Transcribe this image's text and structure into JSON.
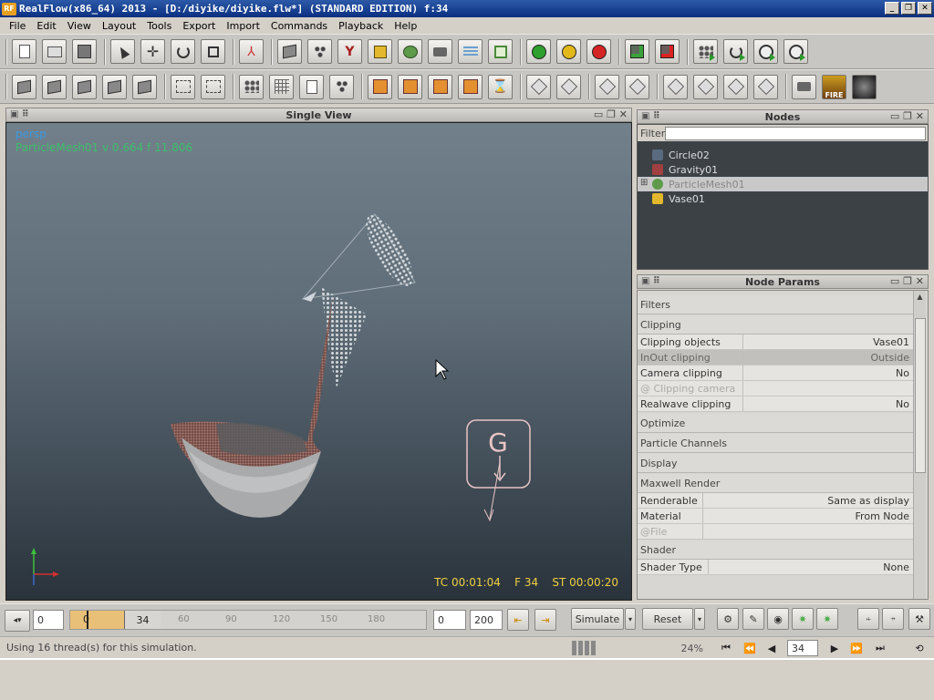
{
  "window": {
    "title": "RealFlow(x86_64) 2013 - [D:/diyike/diyike.flw*] (STANDARD EDITION) f:34",
    "app_icon": "RF",
    "minimize": "_",
    "maximize": "❐",
    "close": "✕"
  },
  "menu": [
    "File",
    "Edit",
    "View",
    "Layout",
    "Tools",
    "Export",
    "Import",
    "Commands",
    "Playback",
    "Help"
  ],
  "viewport": {
    "title": "Single View",
    "camera": "persp",
    "info": "ParticleMesh01 v 0.664 f 11.806",
    "gravity_label": "G",
    "timecode": "TC 00:01:04    F 34    ST 00:00:20"
  },
  "nodes": {
    "title": "Nodes",
    "filter_label": "Filter",
    "items": [
      {
        "label": "Circle02",
        "icon": "emitter-icon",
        "color": "#5a6a80"
      },
      {
        "label": "Gravity01",
        "icon": "daemon-icon",
        "color": "#a04040"
      },
      {
        "label": "ParticleMesh01",
        "icon": "mesh-icon",
        "color": "#5d9a4a"
      },
      {
        "label": "Vase01",
        "icon": "object-icon",
        "color": "#e3b82c"
      }
    ]
  },
  "params": {
    "title": "Node Params",
    "sections": {
      "filters": "Filters",
      "clipping": "Clipping",
      "optimize": "Optimize",
      "channels": "Particle Channels",
      "display": "Display",
      "maxwell": "Maxwell Render",
      "shader": "Shader"
    },
    "clipping_rows": [
      {
        "label": "Clipping objects",
        "value": "Vase01"
      },
      {
        "label": "InOut clipping",
        "value": "Outside"
      },
      {
        "label": "Camera clipping",
        "value": "No"
      },
      {
        "label": "@ Clipping camera",
        "value": ""
      },
      {
        "label": "Realwave clipping",
        "value": "No"
      }
    ],
    "maxwell_rows": [
      {
        "label": "Renderable",
        "value": "Same as display"
      },
      {
        "label": "Material",
        "value": "From Node"
      },
      {
        "label": "@File",
        "value": ""
      }
    ],
    "shader_rows": [
      {
        "label": "Shader Type",
        "value": "None"
      }
    ]
  },
  "timeline": {
    "start": "0",
    "range_start": "0",
    "current_frame": "34",
    "ticks": [
      "60",
      "90",
      "120",
      "150",
      "180"
    ],
    "end_start": "0",
    "end": "200",
    "simulate": "Simulate",
    "reset": "Reset",
    "range_fraction": 0.15
  },
  "status": {
    "message": "Using 16 thread(s) for this simulation.",
    "progress": "24%",
    "frame_field": "34"
  },
  "colors": {
    "accent": "#0b2f80",
    "mesh": "#8a5a52",
    "particles": "#d8dcdf",
    "gravity": "#e8c4c4",
    "viewport_info": "#3dbf6a",
    "camera_label": "#3a9ae0"
  }
}
